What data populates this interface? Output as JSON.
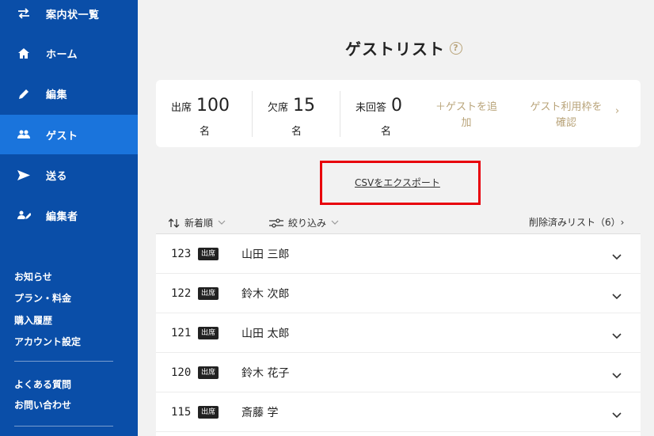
{
  "sidebar": {
    "nav": [
      {
        "label": "案内状一覧",
        "icon": "transfer-arrows-icon"
      },
      {
        "label": "ホーム",
        "icon": "home-icon"
      },
      {
        "label": "編集",
        "icon": "pencil-icon"
      },
      {
        "label": "ゲスト",
        "icon": "people-icon",
        "active": true
      },
      {
        "label": "送る",
        "icon": "send-icon"
      },
      {
        "label": "編集者",
        "icon": "editor-icon"
      }
    ],
    "links_primary": [
      "お知らせ",
      "プラン・料金",
      "購入履歴",
      "アカウント設定"
    ],
    "links_secondary": [
      "よくある質問",
      "お問い合わせ"
    ]
  },
  "page": {
    "title": "ゲストリスト",
    "help_glyph": "?"
  },
  "summary": {
    "attending": {
      "label": "出席",
      "value": "100",
      "unit": "名"
    },
    "absent": {
      "label": "欠席",
      "value": "15",
      "unit": "名"
    },
    "no_reply": {
      "label": "未回答",
      "value": "0",
      "unit": "名"
    },
    "add_guest": {
      "line1": "＋ゲストを追",
      "line2": "加"
    },
    "quota": {
      "line1": "ゲスト利用枠を",
      "line2": "確認"
    },
    "chevron": "›"
  },
  "csv_export_label": "CSVをエクスポート",
  "toolbar": {
    "sort_label": "新着順",
    "filter_label": "絞り込み",
    "deleted_label": "削除済みリスト（6）›"
  },
  "guests": [
    {
      "no": "123",
      "status": "出席",
      "name": "山田 三郎"
    },
    {
      "no": "122",
      "status": "出席",
      "name": "鈴木 次郎"
    },
    {
      "no": "121",
      "status": "出席",
      "name": "山田 太郎"
    },
    {
      "no": "120",
      "status": "出席",
      "name": "鈴木 花子"
    },
    {
      "no": "115",
      "status": "出席",
      "name": "斎藤 学"
    }
  ],
  "colors": {
    "sidebar_bg": "#0a4ea8",
    "sidebar_active": "#1a74dc",
    "accent_gold": "#b9a47a",
    "highlight_red": "#e8000b"
  }
}
